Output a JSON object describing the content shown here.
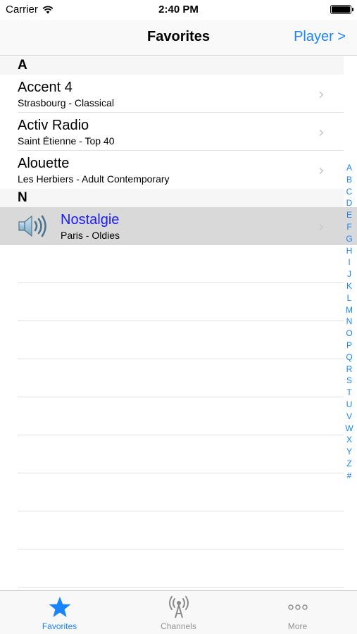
{
  "status_bar": {
    "carrier": "Carrier",
    "time": "2:40 PM",
    "battery_level": 1.0
  },
  "nav": {
    "title": "Favorites",
    "right_button": "Player >"
  },
  "sections": [
    {
      "header": "A",
      "rows": [
        {
          "title": "Accent 4",
          "subtitle": "Strasbourg - Classical"
        },
        {
          "title": "Activ Radio",
          "subtitle": "Saint Étienne - Top 40"
        },
        {
          "title": "Alouette",
          "subtitle": "Les Herbiers - Adult Contemporary"
        }
      ]
    },
    {
      "header": "N",
      "rows": [
        {
          "title": "Nostalgie",
          "subtitle": "Paris - Oldies",
          "playing": true
        }
      ]
    }
  ],
  "index_letters": [
    "A",
    "B",
    "C",
    "D",
    "E",
    "F",
    "G",
    "H",
    "I",
    "J",
    "K",
    "L",
    "M",
    "N",
    "O",
    "P",
    "Q",
    "R",
    "S",
    "T",
    "U",
    "V",
    "W",
    "X",
    "Y",
    "Z",
    "#"
  ],
  "tabs": [
    {
      "label": "Favorites",
      "icon": "star-icon",
      "active": true
    },
    {
      "label": "Channels",
      "icon": "antenna-icon",
      "active": false
    },
    {
      "label": "More",
      "icon": "more-icon",
      "active": false
    }
  ],
  "colors": {
    "accent": "#1a84ff",
    "selected_row": "#d9d9d9",
    "playing_title": "#1a1aff"
  }
}
